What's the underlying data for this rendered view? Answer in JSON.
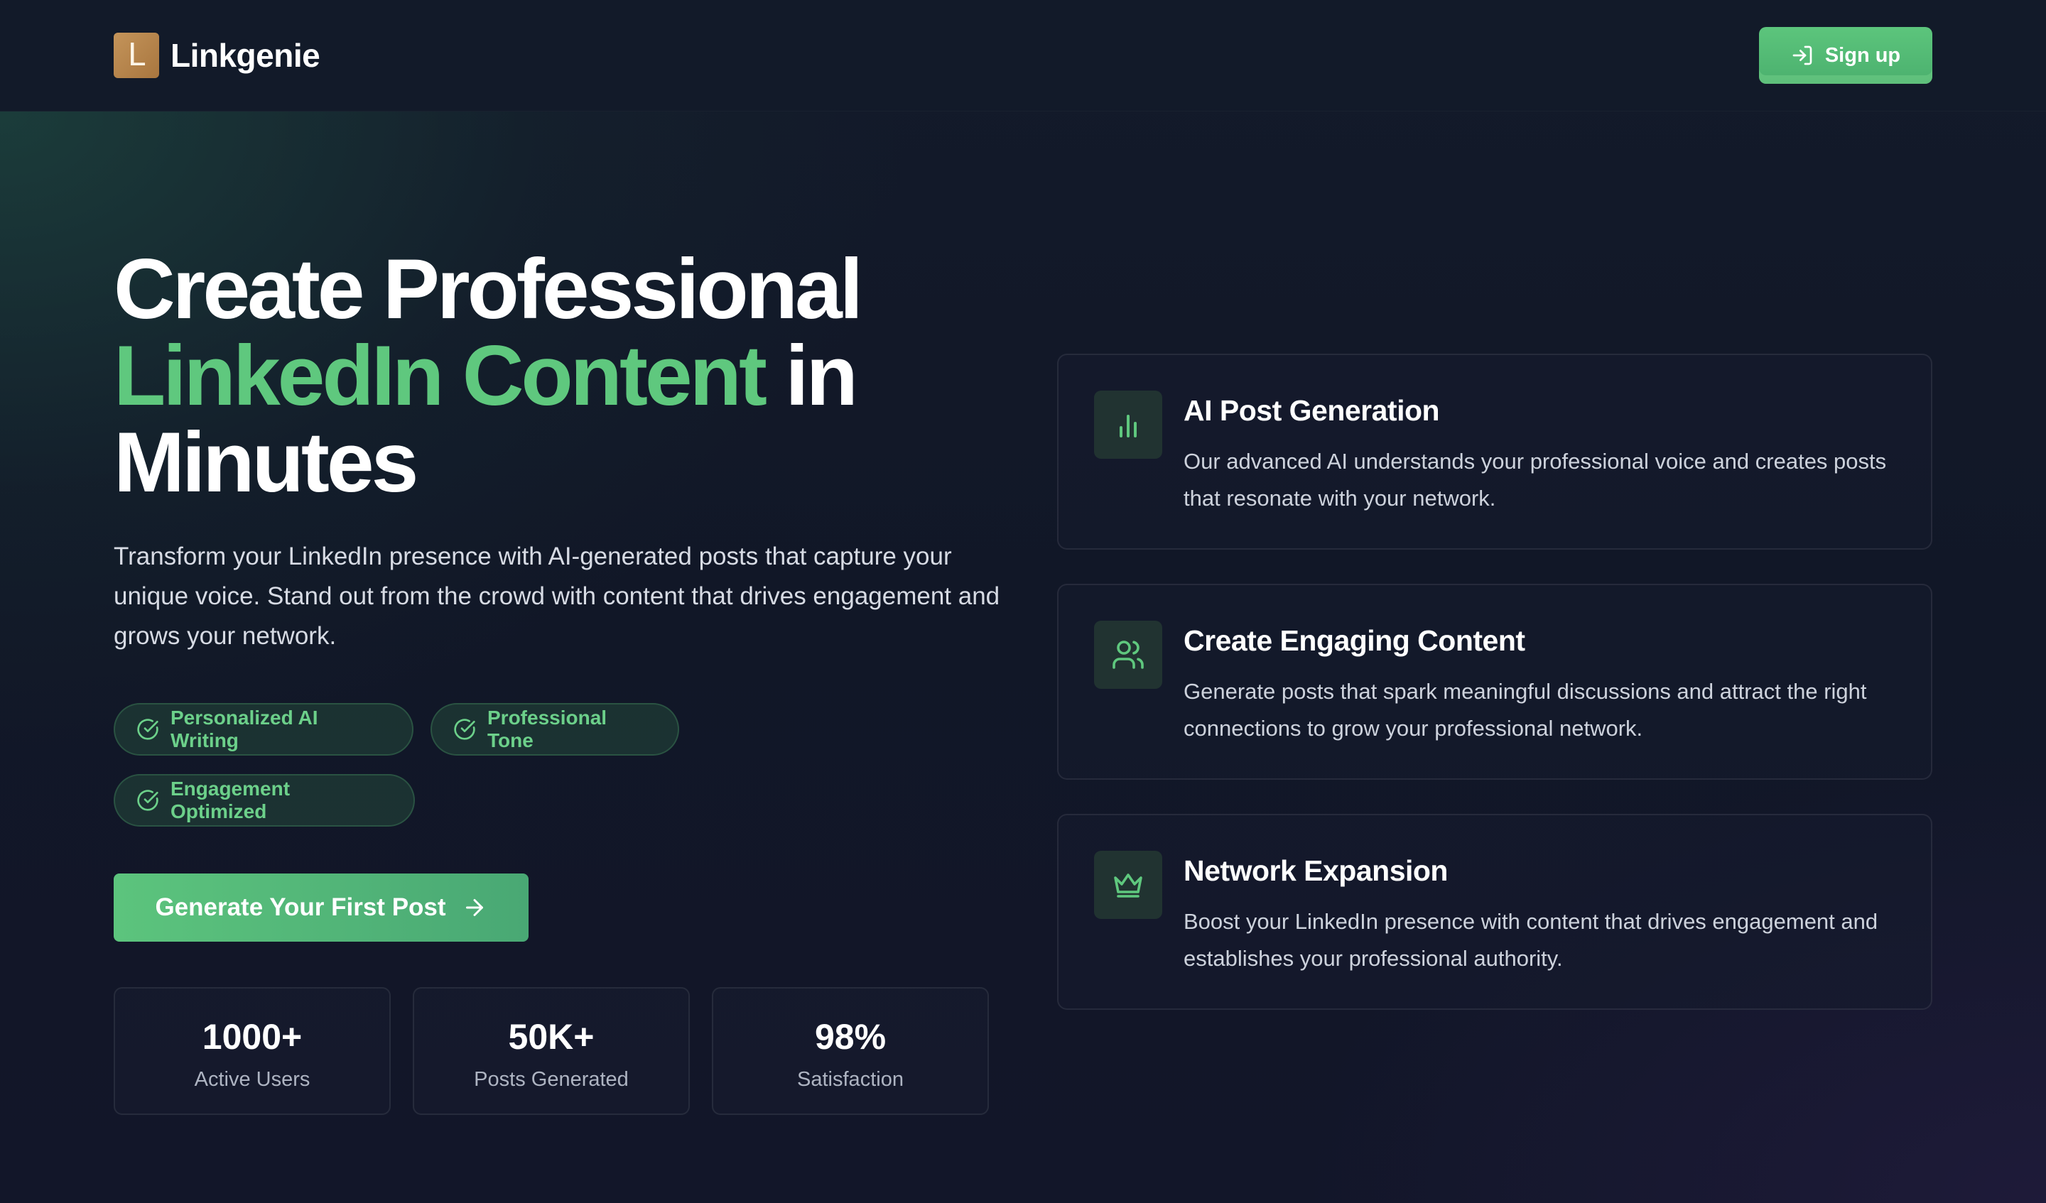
{
  "header": {
    "logo_letter": "L",
    "brand_name": "Linkgenie",
    "signup_label": "Sign up"
  },
  "hero": {
    "title_line1": "Create Professional",
    "title_accent": "LinkedIn Content",
    "title_after_accent": " in",
    "title_line3": "Minutes",
    "description": "Transform your LinkedIn presence with AI-generated posts that capture your unique voice. Stand out from the crowd with content that drives engagement and grows your network.",
    "features": [
      "Personalized AI Writing",
      "Professional Tone",
      "Engagement Optimized"
    ],
    "cta_label": "Generate Your First Post"
  },
  "stats": [
    {
      "value": "1000+",
      "label": "Active Users"
    },
    {
      "value": "50K+",
      "label": "Posts Generated"
    },
    {
      "value": "98%",
      "label": "Satisfaction"
    }
  ],
  "cards": [
    {
      "icon": "bar-chart-icon",
      "title": "AI Post Generation",
      "description": "Our advanced AI understands your professional voice and creates posts that resonate with your network."
    },
    {
      "icon": "users-icon",
      "title": "Create Engaging Content",
      "description": "Generate posts that spark meaningful discussions and attract the right connections to grow your professional network."
    },
    {
      "icon": "crown-icon",
      "title": "Network Expansion",
      "description": "Boost your LinkedIn presence with content that drives engagement and establishes your professional authority."
    }
  ],
  "colors": {
    "accent": "#5fc87e",
    "background": "#111727",
    "logo": "#b98549"
  }
}
